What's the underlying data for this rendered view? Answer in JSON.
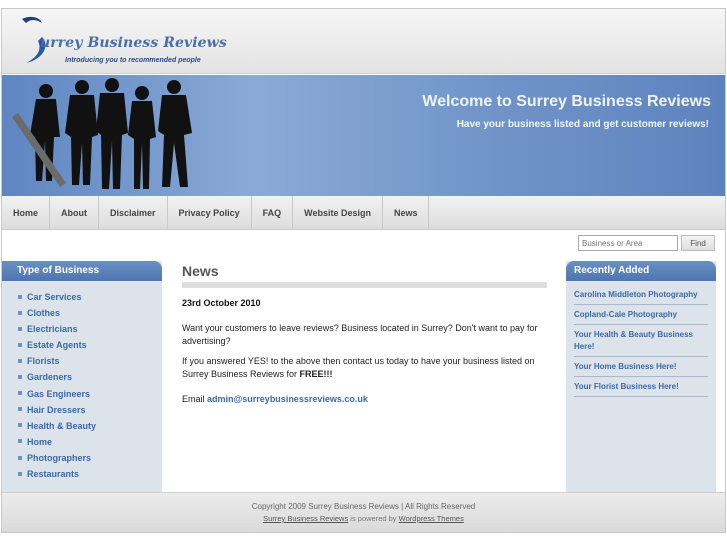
{
  "site": {
    "name": "urrey Business Reviews",
    "tagline": "Introducing you to recommended people"
  },
  "banner": {
    "title": "Welcome to Surrey Business Reviews",
    "subtitle": "Have your business listed and get customer reviews!"
  },
  "nav": {
    "items": [
      "Home",
      "About",
      "Disclaimer",
      "Privacy Policy",
      "FAQ",
      "Website Design",
      "News"
    ]
  },
  "search": {
    "placeholder": "Business or Area",
    "button_label": "Find"
  },
  "left_sidebar": {
    "title": "Type of Business",
    "categories": [
      "Car Services",
      "Clothes",
      "Electricians",
      "Estate Agents",
      "Florists",
      "Gardeners",
      "Gas Engineers",
      "Hair Dressers",
      "Health & Beauty",
      "Home",
      "Photographers",
      "Restaurants"
    ]
  },
  "main": {
    "title": "News",
    "date": "23rd October 2010",
    "para1": "Want your customers to leave reviews?  Business located in Surrey?  Don't want to pay for advertising?",
    "para2_start": "If you answered YES! to the above then contact us today to have your business listed on Surrey Business Reviews for ",
    "para2_bold": "FREE!!!",
    "email_label": "Email ",
    "email": "admin@surreybusinessreviews.co.uk"
  },
  "right_sidebar": {
    "title": "Recently Added",
    "items": [
      "Carolina Middleton Photography",
      "Copland-Cale Photography",
      "Your Health & Beauty Business Here!",
      "Your Home Business Here!",
      "Your Florist Business Here!"
    ]
  },
  "footer": {
    "copyright": "Copyright 2009 Surrey Business Reviews | All Rights Reserved",
    "site_link": "Surrey Business Reviews",
    "powered_text": " is powered by ",
    "theme_link": "Wordpress Themes"
  },
  "colors": {
    "accent": "#4f75b0",
    "link": "#3b6aa6",
    "sidebar_bg": "#dde3eb"
  }
}
